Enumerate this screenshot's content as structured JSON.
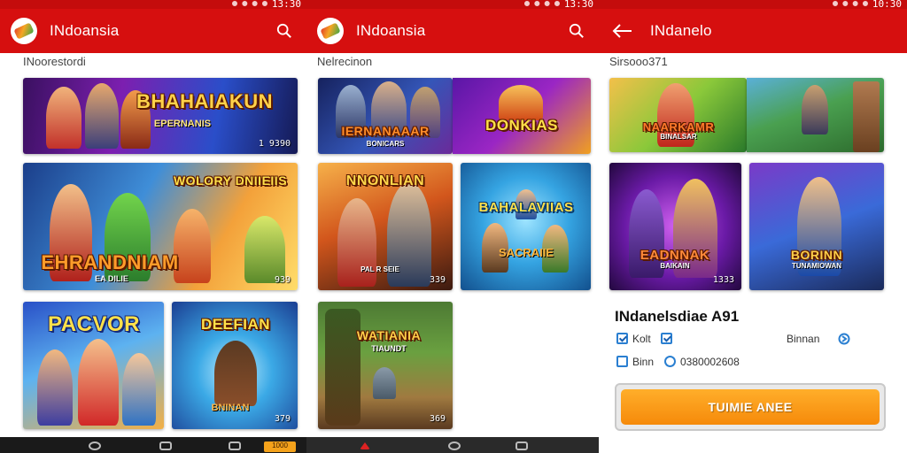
{
  "screens": [
    {
      "app_title": "INdoansia",
      "status_time": "13:30",
      "section_label": "INoorestordi",
      "cards": [
        {
          "title": "BHAHAIAKUN",
          "subtitle": "EPERNANIS",
          "count": "1 9390"
        },
        {
          "title": "EHRANDNIAM",
          "subtitle": "EA DILIE",
          "extra_title": "WOLORY DNIIEIIS",
          "count": "939"
        },
        {
          "title": "PACVOR",
          "count": ""
        },
        {
          "title": "DEEFIAN",
          "subtitle": "BNINAN",
          "count": "379"
        }
      ]
    },
    {
      "app_title": "INdoansia",
      "status_time": "13:30",
      "section_label": "Nelrecinon",
      "cards": [
        {
          "title": "IERNANAAAR",
          "subtitle": "BONICARS",
          "count": ""
        },
        {
          "title": "DONKIAS",
          "count": ""
        },
        {
          "title": "NNONLIAN",
          "subtitle": "PAL R SEIE",
          "count": "339"
        },
        {
          "title": "BAHALAVIIAS",
          "subtitle": "SACRAIIE",
          "count": ""
        },
        {
          "title": "WATIANIA",
          "subtitle": "TIAUNDT",
          "count": "369"
        }
      ]
    },
    {
      "app_title": "INdanelo",
      "status_time": "10:30",
      "section_label": "Sirsooo371",
      "cards": [
        {
          "title": "NAARKAMR",
          "subtitle": "BINALSAR",
          "count": ""
        },
        {
          "title": "",
          "count": ""
        },
        {
          "title": "EADNNAK",
          "subtitle": "BAIKAIN",
          "count": "1333"
        },
        {
          "title": "BORINN",
          "subtitle": "TUNAMIOWAN",
          "count": ""
        }
      ],
      "info": {
        "title": "INdanelsdiae A91",
        "option_1": "Kolt",
        "option_2": "Binnan",
        "option_3": "Binn",
        "option_4": "0380002608",
        "cta_label": "TUIMIE ANEE"
      }
    }
  ],
  "nav": {
    "badge_1": "1000"
  },
  "colors": {
    "appbar": "#d60f0f",
    "statusbar": "#c40c0c",
    "cta": "#f68a0a",
    "check": "#2a7fd1"
  },
  "icons": [
    "search-icon",
    "back-arrow-icon",
    "app-logo-icon",
    "checkbox-icon",
    "share-icon"
  ]
}
